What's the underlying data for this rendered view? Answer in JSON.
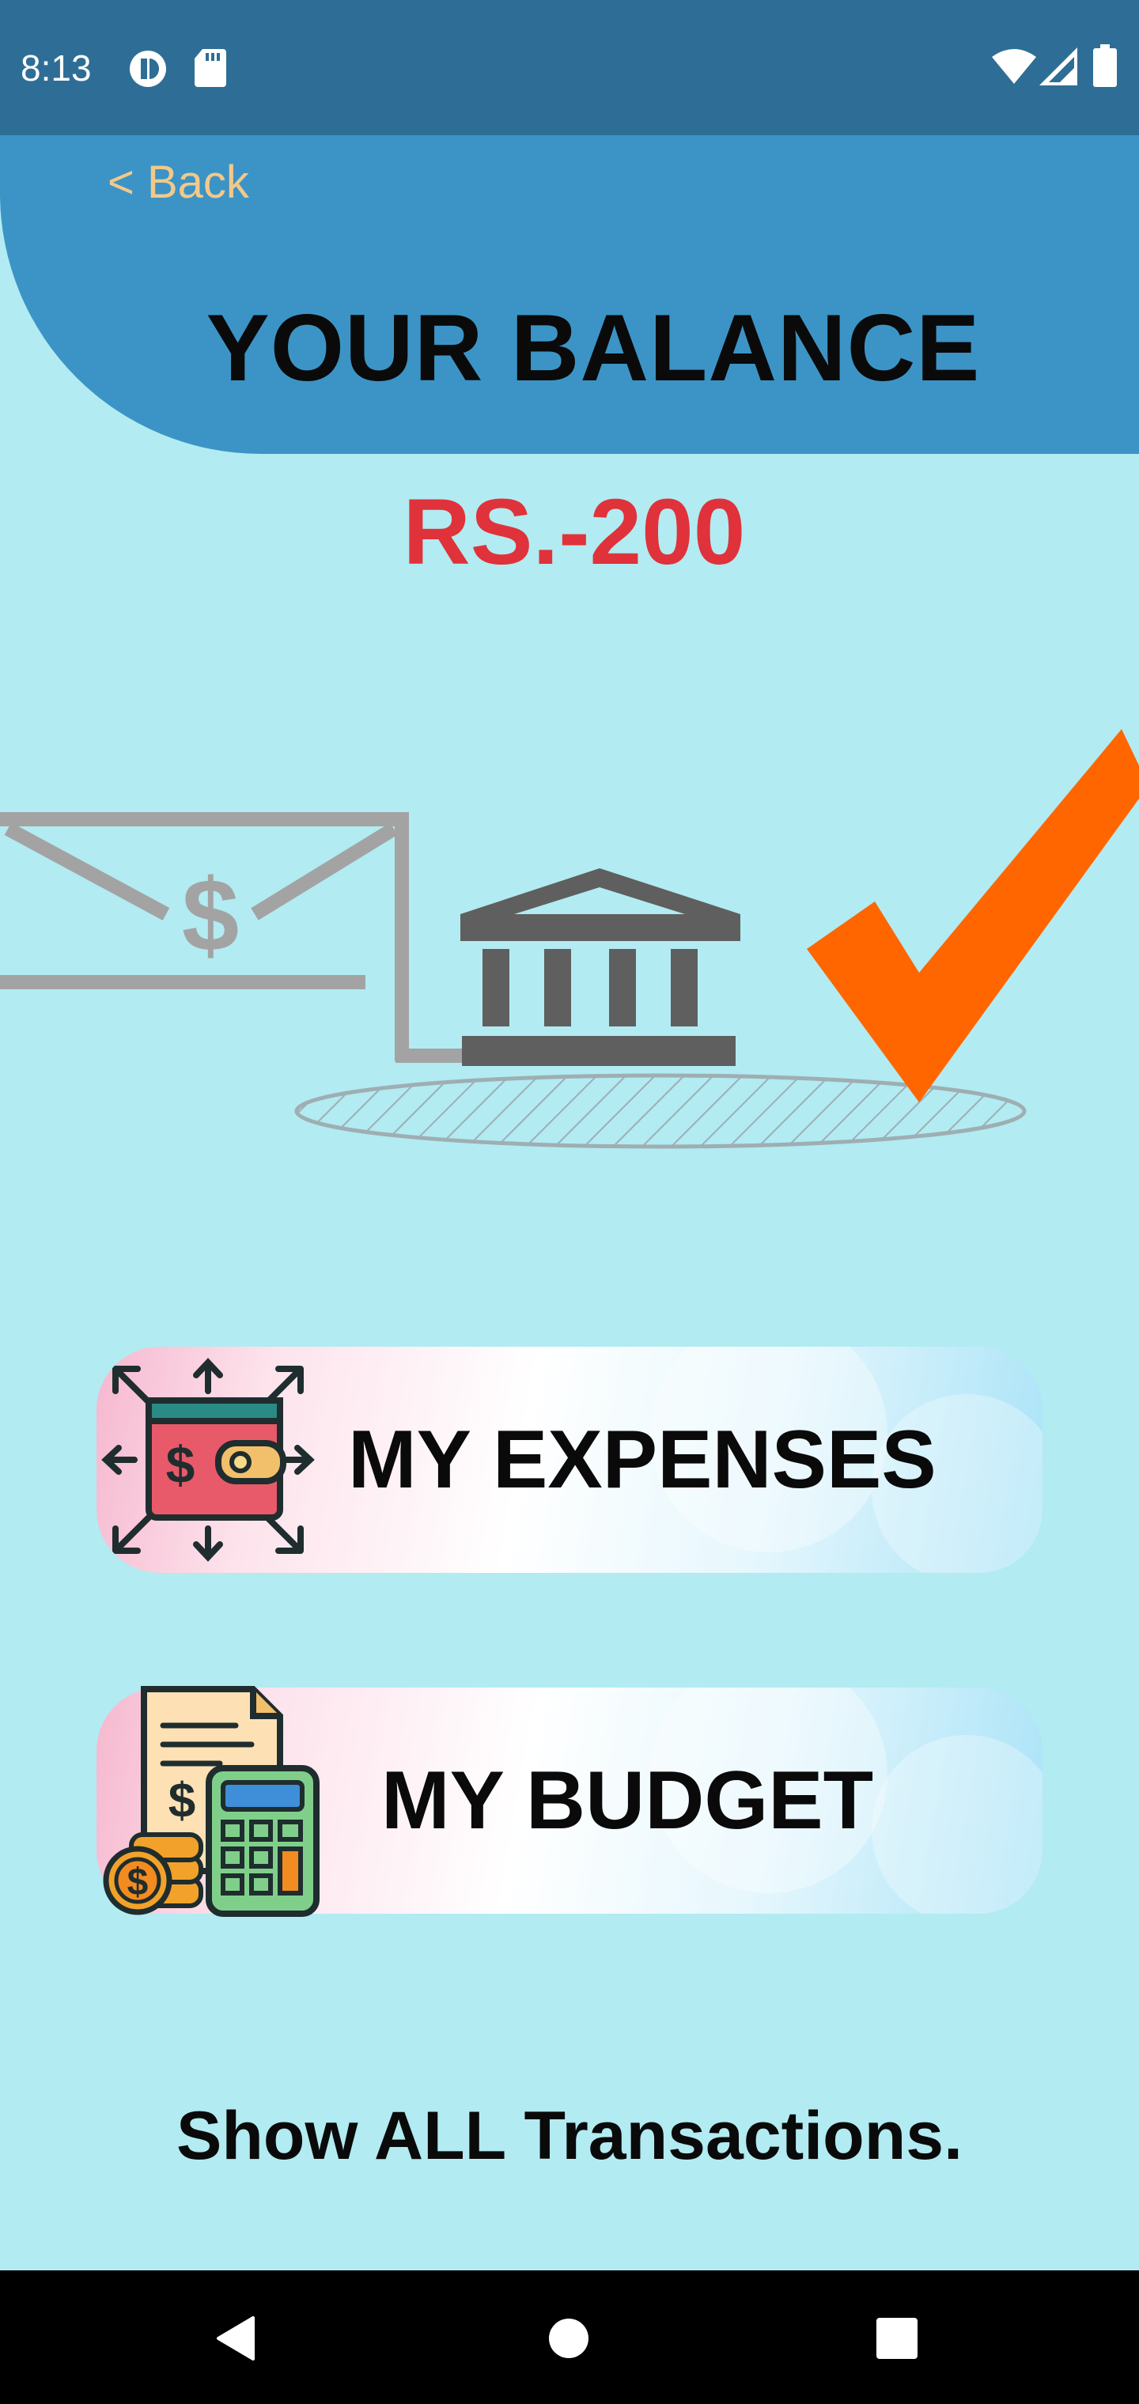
{
  "status_bar": {
    "time": "8:13",
    "left_icons": [
      "notification-app-icon",
      "sd-card-icon"
    ],
    "right_icons": [
      "wifi-icon",
      "cell-signal-icon",
      "battery-icon"
    ]
  },
  "header": {
    "back_label": "< Back",
    "title": "YOUR BALANCE",
    "color": "#3c94c6"
  },
  "balance": {
    "text": "RS.-200",
    "color": "#e0323a"
  },
  "illustration": {
    "envelope_symbol": "$",
    "icons": [
      "money-envelope-icon",
      "bank-icon",
      "checkmark-icon"
    ]
  },
  "menu": [
    {
      "label": "MY EXPENSES",
      "icon": "wallet-expenses-icon"
    },
    {
      "label": "MY BUDGET",
      "icon": "budget-calculator-icon"
    }
  ],
  "show_all_label": "Show ALL Transactions.",
  "nav_bar": {
    "buttons": [
      "back-triangle-icon",
      "home-circle-icon",
      "recents-square-icon"
    ]
  },
  "colors": {
    "background": "#b2ebf2",
    "status_bar": "#2e6e96",
    "back_link": "#f2c98a",
    "checkmark": "#ff6600"
  }
}
